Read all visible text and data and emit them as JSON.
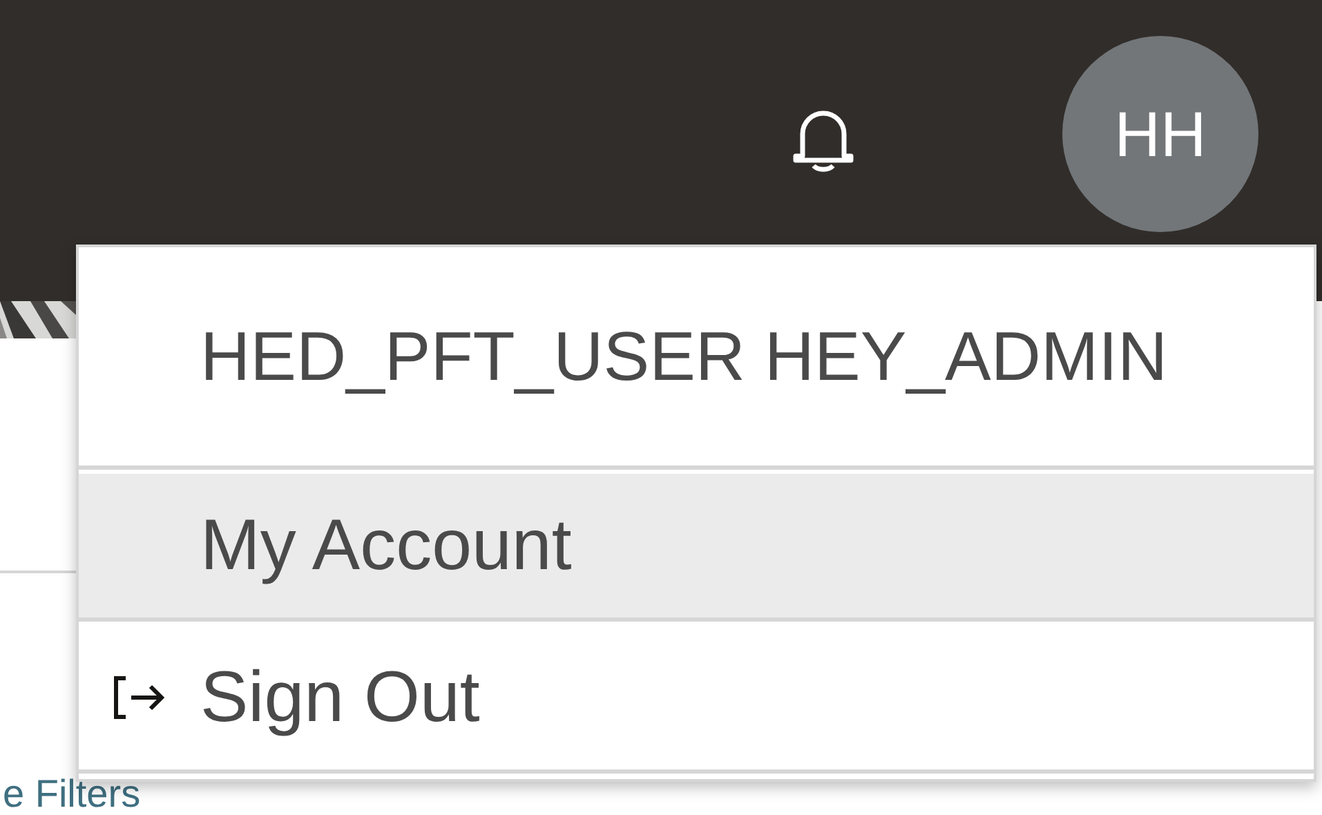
{
  "header": {
    "avatar": {
      "initials": "HH"
    }
  },
  "user_menu": {
    "user_name": "HED_PFT_USER HEY_ADMIN",
    "items": [
      {
        "label": "My Account",
        "kind": "plain",
        "selected": true
      },
      {
        "label": "Sign Out",
        "kind": "sign-out",
        "selected": false
      }
    ]
  },
  "page": {
    "link": "e Filters"
  }
}
